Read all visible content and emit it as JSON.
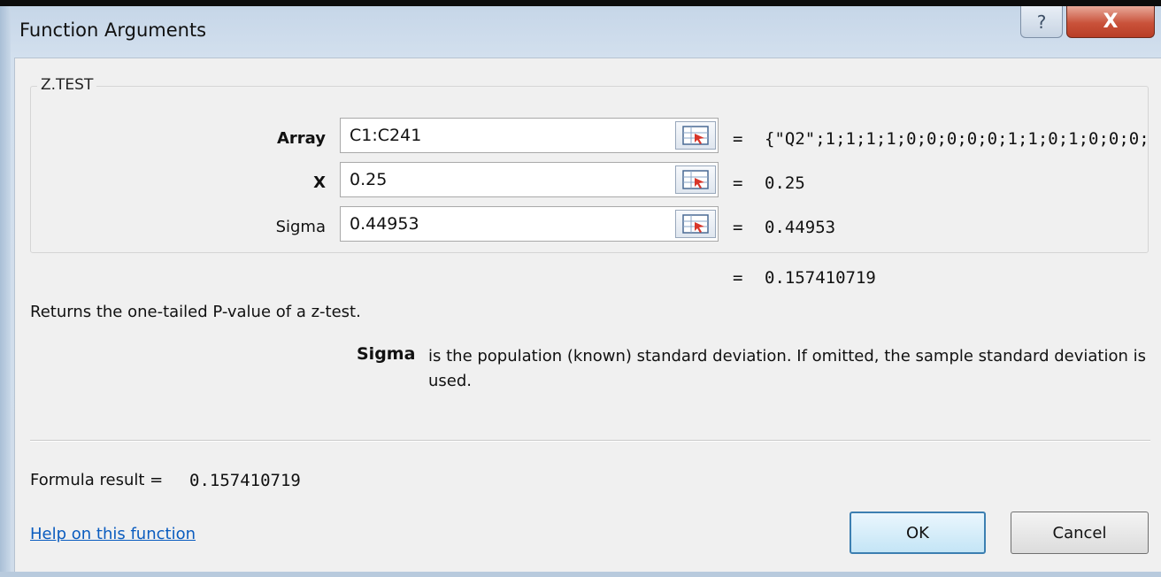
{
  "window": {
    "title": "Function Arguments",
    "help_glyph": "?",
    "close_glyph": "X"
  },
  "function_name": "Z.TEST",
  "arguments": [
    {
      "label": "Array",
      "bold": true,
      "value": "C1:C241",
      "result": "{\"Q2\";1;1;1;1;0;0;0;0;0;1;1;0;1;0;0;0;"
    },
    {
      "label": "X",
      "bold": true,
      "value": "0.25",
      "result": "0.25"
    },
    {
      "label": "Sigma",
      "bold": false,
      "value": "0.44953",
      "result": "0.44953"
    }
  ],
  "equals_sign": "=",
  "function_result": "0.157410719",
  "description": "Returns the one-tailed P-value of a z-test.",
  "argument_help": {
    "name": "Sigma",
    "text": "is the population (known) standard deviation. If omitted, the sample standard deviation is used."
  },
  "formula_result": {
    "label": "Formula result =",
    "value": "0.157410719"
  },
  "help_link": "Help on this function",
  "buttons": {
    "ok": "OK",
    "cancel": "Cancel"
  },
  "icons": {
    "collapse_dialog": "range-select-icon",
    "help": "question-icon",
    "close": "close-icon"
  }
}
